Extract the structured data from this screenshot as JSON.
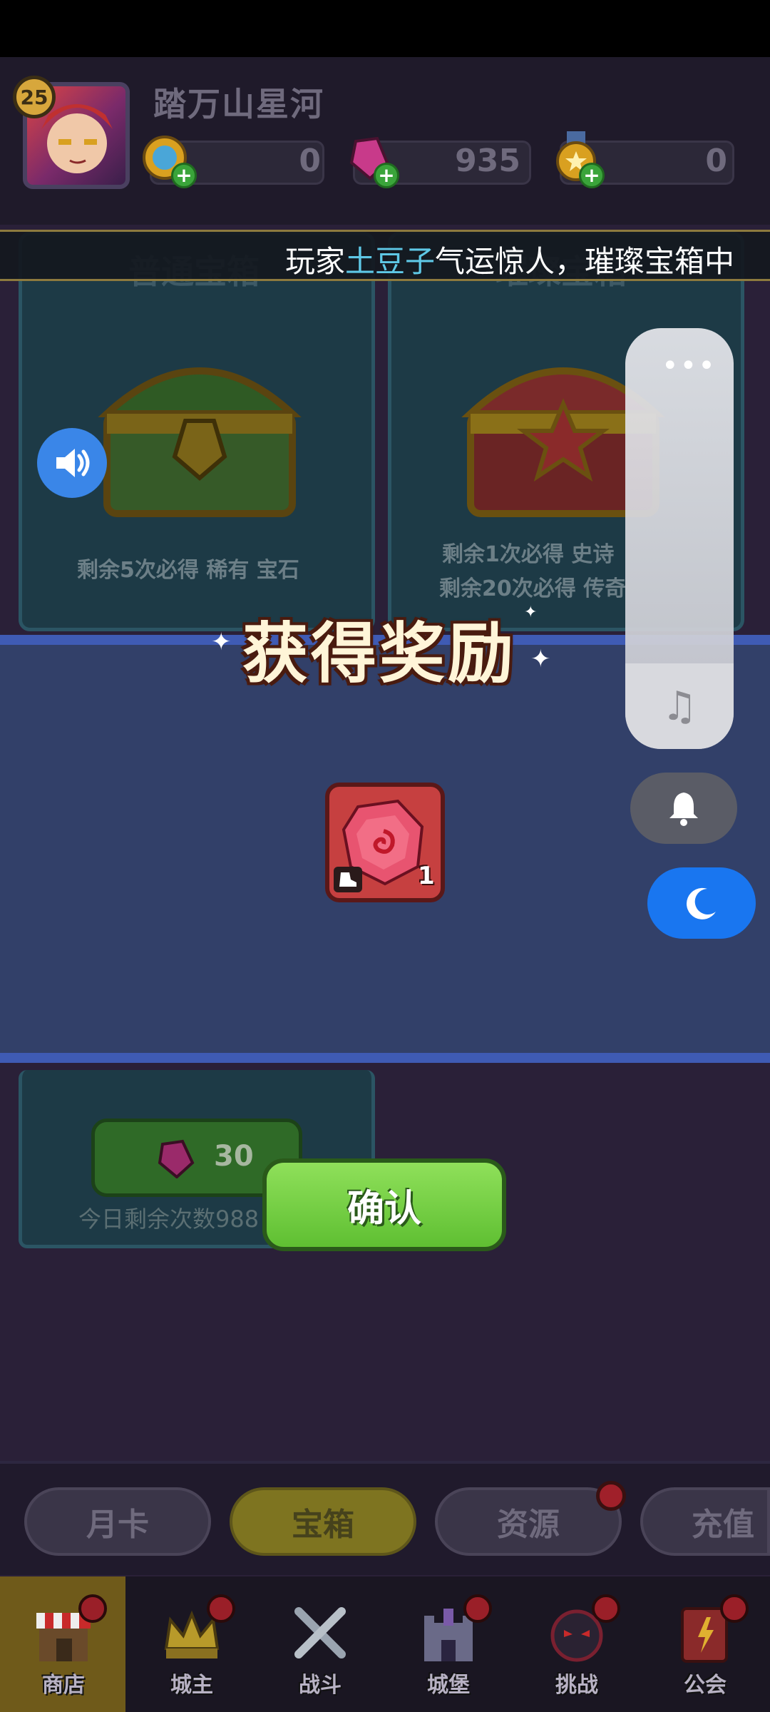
{
  "header": {
    "level": "25",
    "player_name": "踏万山星河",
    "currencies": [
      {
        "icon": "coin-icon",
        "value": "0"
      },
      {
        "icon": "gem-icon",
        "value": "935"
      },
      {
        "icon": "medal-icon",
        "value": "0"
      }
    ]
  },
  "ticker": {
    "prefix": "玩家",
    "highlight": "土豆子",
    "suffix": "气运惊人，璀璨宝箱中"
  },
  "chests": [
    {
      "title": "普通宝箱",
      "hint": "剩余5次必得 稀有 宝石"
    },
    {
      "title": "璀璨宝箱",
      "hint_1": "剩余1次必得 史诗",
      "hint_2": "剩余20次必得 传奇"
    }
  ],
  "reward_dialog": {
    "title": "获得奖励",
    "item": {
      "icon": "red-gem-icon",
      "count": "1"
    },
    "confirm_label": "确认"
  },
  "lower_chest": {
    "price": "30",
    "daily_remaining": "今日剩余次数988"
  },
  "tabs": [
    {
      "label": "月卡",
      "active": false
    },
    {
      "label": "宝箱",
      "active": true
    },
    {
      "label": "资源",
      "active": false
    },
    {
      "label": "充值",
      "active": false
    }
  ],
  "bottom_nav": [
    {
      "label": "商店",
      "icon": "shop-icon",
      "active": true
    },
    {
      "label": "城主",
      "icon": "crown-icon",
      "active": false
    },
    {
      "label": "战斗",
      "icon": "swords-icon",
      "active": false
    },
    {
      "label": "城堡",
      "icon": "castle-icon",
      "active": false
    },
    {
      "label": "挑战",
      "icon": "challenge-icon",
      "active": false
    },
    {
      "label": "公会",
      "icon": "guild-icon",
      "active": false
    }
  ],
  "colors": {
    "accent_blue": "#1976f0",
    "confirm_green": "#6fcf3f",
    "panel_blue": "#324069"
  }
}
